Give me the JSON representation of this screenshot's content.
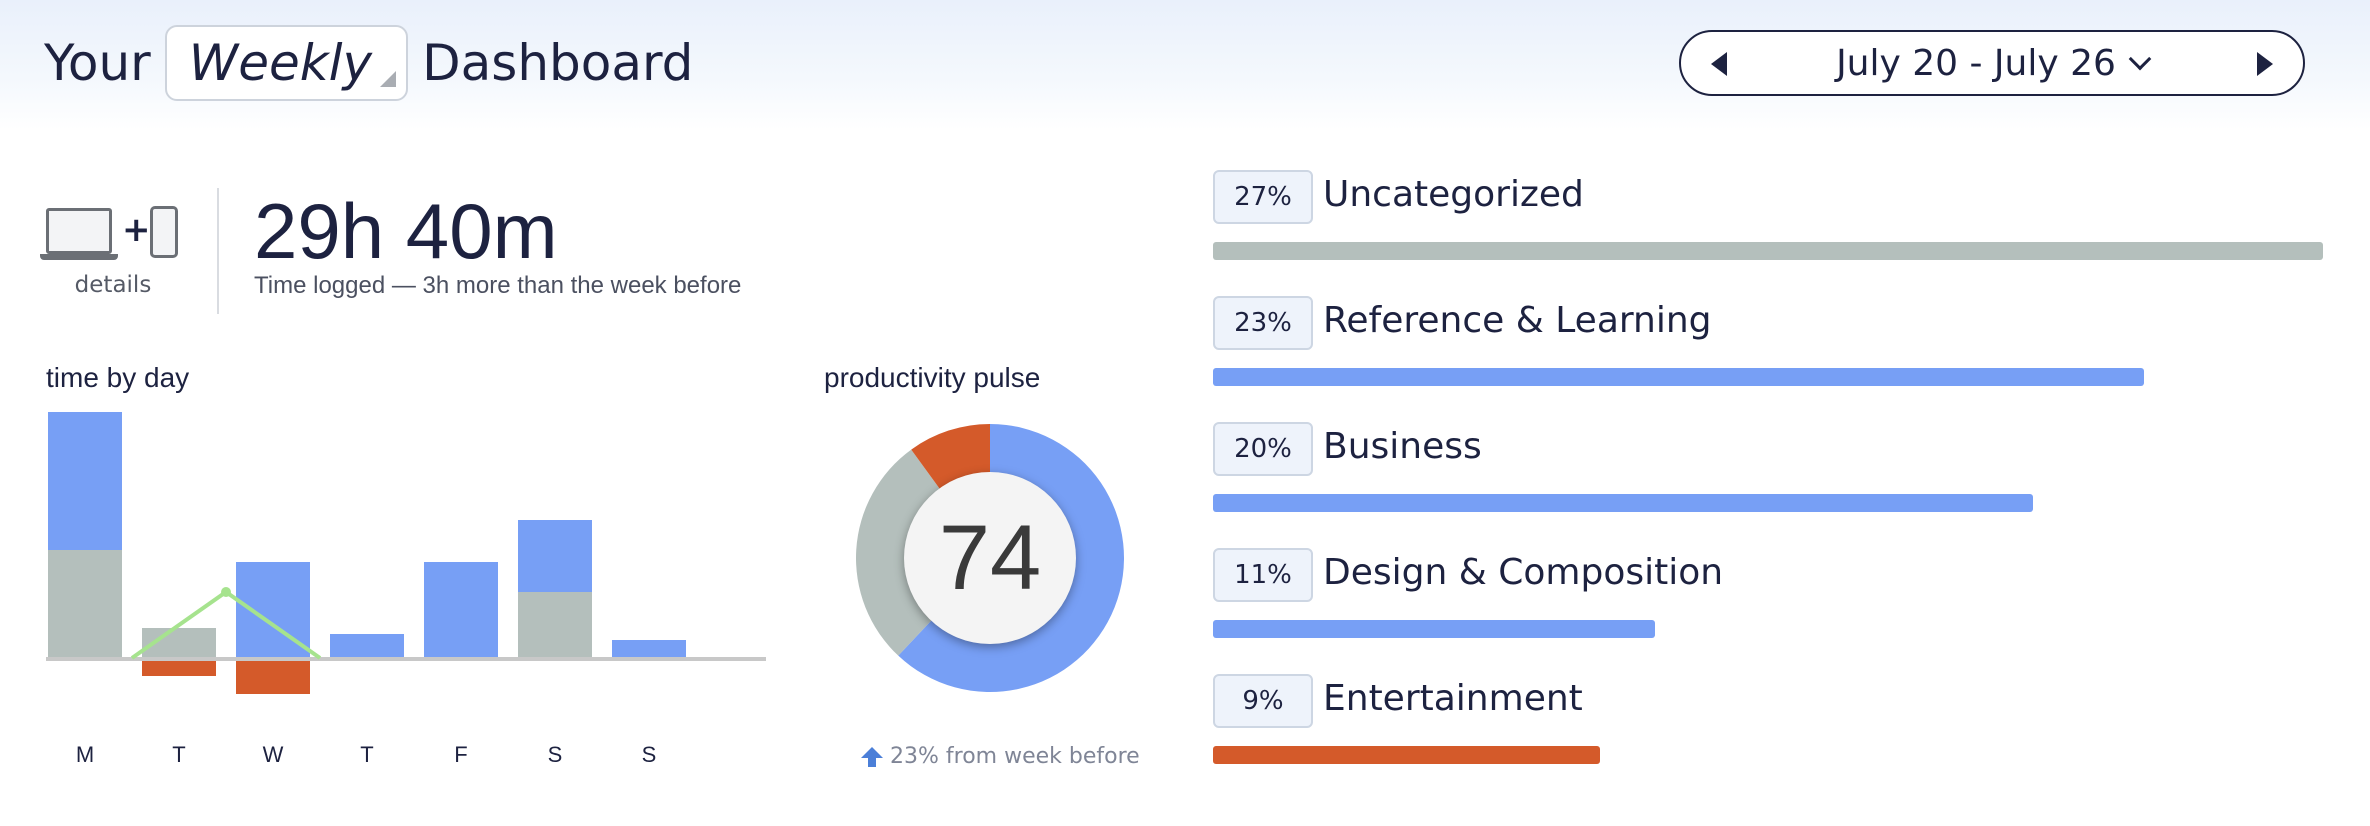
{
  "header": {
    "title_prefix": "Your",
    "period": "Weekly",
    "title_suffix": "Dashboard",
    "date_range": "July 20 - July 26",
    "icons": [
      "previous-week-icon",
      "chevron-down-icon",
      "next-week-icon"
    ]
  },
  "summary": {
    "details_label": "details",
    "time_logged": "29h 40m",
    "time_sub": "Time logged — 3h more than the week before",
    "icons": [
      "laptop-icon",
      "plus-icon",
      "phone-icon"
    ]
  },
  "time_by_day": {
    "label": "time by day",
    "colors": {
      "productive": "#779ff5",
      "neutral": "#b4bfbc",
      "distracting": "#d45a2a",
      "trend": "#a6e38e",
      "axis": "#c8c8c8"
    }
  },
  "pulse": {
    "label": "productivity pulse",
    "score": "74",
    "change": "23% from week before",
    "colors": {
      "productive": "#779ff5",
      "neutral": "#b4bfbc",
      "distracting": "#d45a2a"
    }
  },
  "categories": [
    {
      "percent": "27%",
      "name": "Uncategorized",
      "fraction": 1.0,
      "color": "#b4bfbc"
    },
    {
      "percent": "23%",
      "name": "Reference & Learning",
      "fraction": 0.839,
      "color": "#779ff5"
    },
    {
      "percent": "20%",
      "name": "Business",
      "fraction": 0.739,
      "color": "#779ff5"
    },
    {
      "percent": "11%",
      "name": "Design & Composition",
      "fraction": 0.398,
      "color": "#779ff5"
    },
    {
      "percent": "9%",
      "name": "Entertainment",
      "fraction": 0.349,
      "color": "#d45a2a"
    }
  ],
  "chart_data": [
    {
      "type": "bar",
      "title": "time by day",
      "categories": [
        "M",
        "T",
        "W",
        "T",
        "F",
        "S",
        "S"
      ],
      "series": [
        {
          "values": [
            2.3,
            0.0,
            1.6,
            0.4,
            1.6,
            1.2,
            0.3
          ]
        },
        {
          "values": [
            1.8,
            0.5,
            0.0,
            0.0,
            0.0,
            1.1,
            0.0
          ]
        },
        {
          "values": [
            0.0,
            -0.3,
            -0.6,
            0.0,
            0.0,
            0.0,
            0.0
          ]
        }
      ],
      "trend": [
        0.0,
        1.1,
        0.0
      ],
      "ylim": [
        -0.6,
        4.1
      ]
    },
    {
      "type": "pie",
      "title": "productivity pulse",
      "labels": [],
      "values": [
        62,
        28,
        10
      ],
      "center_value": 74
    }
  ]
}
